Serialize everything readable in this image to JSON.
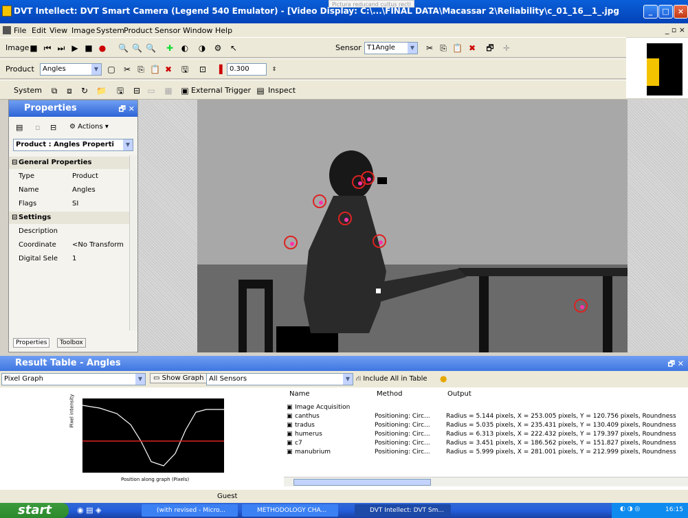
{
  "titlebar": {
    "title": "DVT Intellect: DVT Smart Camera (Legend 540 Emulator) - [Video Display: C:\\...\\FINAL DATA\\Macassar 2\\Reliability\\c_01_16__1_.jpg]",
    "tooltip": "Pictura reducand cultus recti",
    "min": "_",
    "max": "□",
    "close": "×"
  },
  "menu": {
    "items": [
      "File",
      "Edit",
      "View",
      "Image",
      "System",
      "Product",
      "Sensor",
      "Window",
      "Help"
    ],
    "mdi": "_ ▫ ×"
  },
  "toolbar1": {
    "image_label": "Image",
    "sensor_label": "Sensor",
    "sensor_value": "T1Angle"
  },
  "toolbar2": {
    "product_label": "Product",
    "product_value": "Angles",
    "zoom": "0.300"
  },
  "toolbar3": {
    "system_label": "System",
    "external_trigger": "External Trigger",
    "inspect": "Inspect"
  },
  "properties": {
    "title": "Properties",
    "actions": "Actions",
    "selector": "Product : Angles Properti",
    "general": "General Properties",
    "rows": [
      {
        "k": "Type",
        "v": "Product"
      },
      {
        "k": "Name",
        "v": "Angles"
      },
      {
        "k": "Flags",
        "v": "SI"
      }
    ],
    "settings": "Settings",
    "rows2": [
      {
        "k": "Description",
        "v": ""
      },
      {
        "k": "Coordinate",
        "v": "<No Transform"
      },
      {
        "k": "Digital Sele",
        "v": "1"
      }
    ],
    "tab_properties": "Properties",
    "tab_toolbox": "Toolbox"
  },
  "result_table": {
    "title": "Result Table - Angles",
    "graph_type": "Pixel Graph",
    "show_graph": "Show Graph",
    "sensors": "All Sensors",
    "include_all": "Include All in Table",
    "graph": {
      "ylabel": "Pixel intensity",
      "xlabel": "Position along graph (Pixels)"
    },
    "columns": [
      "Name",
      "Method",
      "Output"
    ],
    "rows": [
      {
        "name": "Image Acquisition",
        "method": "",
        "output": ""
      },
      {
        "name": "canthus",
        "method": "Positioning: Circ...",
        "output": "Radius = 5.144 pixels, X = 253.005 pixels, Y = 120.756 pixels, Roundness"
      },
      {
        "name": "tradus",
        "method": "Positioning: Circ...",
        "output": "Radius = 5.035 pixels, X = 235.431 pixels, Y = 130.409 pixels, Roundness"
      },
      {
        "name": "humerus",
        "method": "Positioning: Circ...",
        "output": "Radius = 6.313 pixels, X = 222.432 pixels, Y = 179.397 pixels, Roundness"
      },
      {
        "name": "c7",
        "method": "Positioning: Circ...",
        "output": "Radius = 3.451 pixels, X = 186.562 pixels, Y = 151.827 pixels, Roundness"
      },
      {
        "name": "manubrium",
        "method": "Positioning: Circ...",
        "output": "Radius = 5.999 pixels, X = 281.001 pixels, Y = 212.999 pixels, Roundness"
      }
    ]
  },
  "status": {
    "user": "Guest"
  },
  "taskbar": {
    "start": "start",
    "tasks": [
      {
        "label": "(with revised - Micro..."
      },
      {
        "label": "METHODOLOGY CHA..."
      },
      {
        "label": "DVT Intellect: DVT Sm..."
      }
    ],
    "clock": "16:15"
  }
}
